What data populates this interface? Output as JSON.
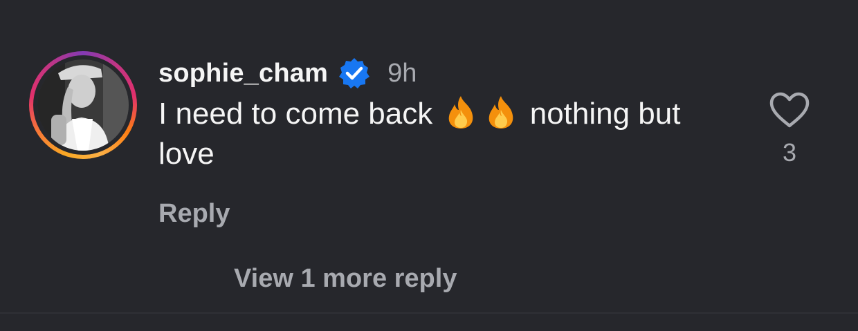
{
  "comment": {
    "username": "sophie_cham",
    "verified": true,
    "time_ago": "9h",
    "text_before": "I need to come back",
    "text_after": "nothing but love",
    "emojis": [
      "fire",
      "fire"
    ],
    "reply_label": "Reply",
    "like_count": "3",
    "view_replies_label": "View 1 more reply"
  },
  "colors": {
    "background": "#26272c",
    "primary_text": "#f5f5f5",
    "secondary_text": "#a8aab0",
    "verified_badge": "#1877f2",
    "fire_orange": "#f4900c",
    "fire_yellow": "#ffcc4d"
  },
  "icons": {
    "verified": "verified-badge-icon",
    "like": "heart-outline-icon",
    "emoji": "fire-emoji-icon"
  }
}
